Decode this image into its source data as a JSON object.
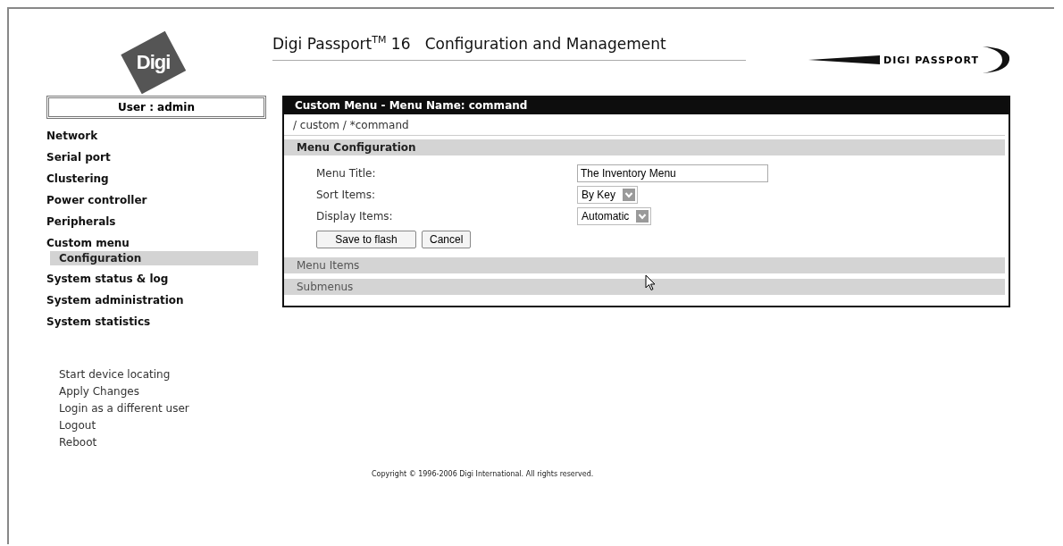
{
  "header": {
    "logo": "Digi",
    "title": "Digi Passport$^{TM}$ 16   Configuration and Management",
    "product_logo": "DIGI PASSPORT"
  },
  "sidebar": {
    "user": "User : admin",
    "items": [
      {
        "label": "Network",
        "selected": false
      },
      {
        "label": "Serial port",
        "selected": false
      },
      {
        "label": "Clustering",
        "selected": false
      },
      {
        "label": "Power controller",
        "selected": false
      },
      {
        "label": "Peripherals",
        "selected": false
      },
      {
        "label": "Custom menu",
        "selected": false,
        "children": [
          {
            "label": "Configuration",
            "selected": true
          }
        ]
      },
      {
        "label": "System status & log",
        "selected": false
      },
      {
        "label": "System administration",
        "selected": false
      },
      {
        "label": "System statistics",
        "selected": false
      }
    ],
    "actions": [
      "Start device locating",
      "Apply Changes",
      "Login as a different user",
      "Logout",
      "Reboot"
    ]
  },
  "panel": {
    "title": "Custom Menu - Menu Name: command",
    "breadcrumb": "/ custom / *command",
    "sections": [
      {
        "title": "Menu Configuration",
        "expanded": true
      },
      {
        "title": "Menu Items",
        "expanded": false
      },
      {
        "title": "Submenus",
        "expanded": false
      }
    ],
    "fields": [
      {
        "label": "Menu Title:",
        "kind": "text",
        "value": "The Inventory Menu"
      },
      {
        "label": "Sort Items:",
        "kind": "select",
        "value": "By Key"
      },
      {
        "label": "Display Items:",
        "kind": "select",
        "value": "Automatic"
      }
    ],
    "buttons": [
      "Save to flash",
      "Cancel"
    ]
  },
  "footer": "Copyright © 1996-2006 Digi International. All rights reserved."
}
